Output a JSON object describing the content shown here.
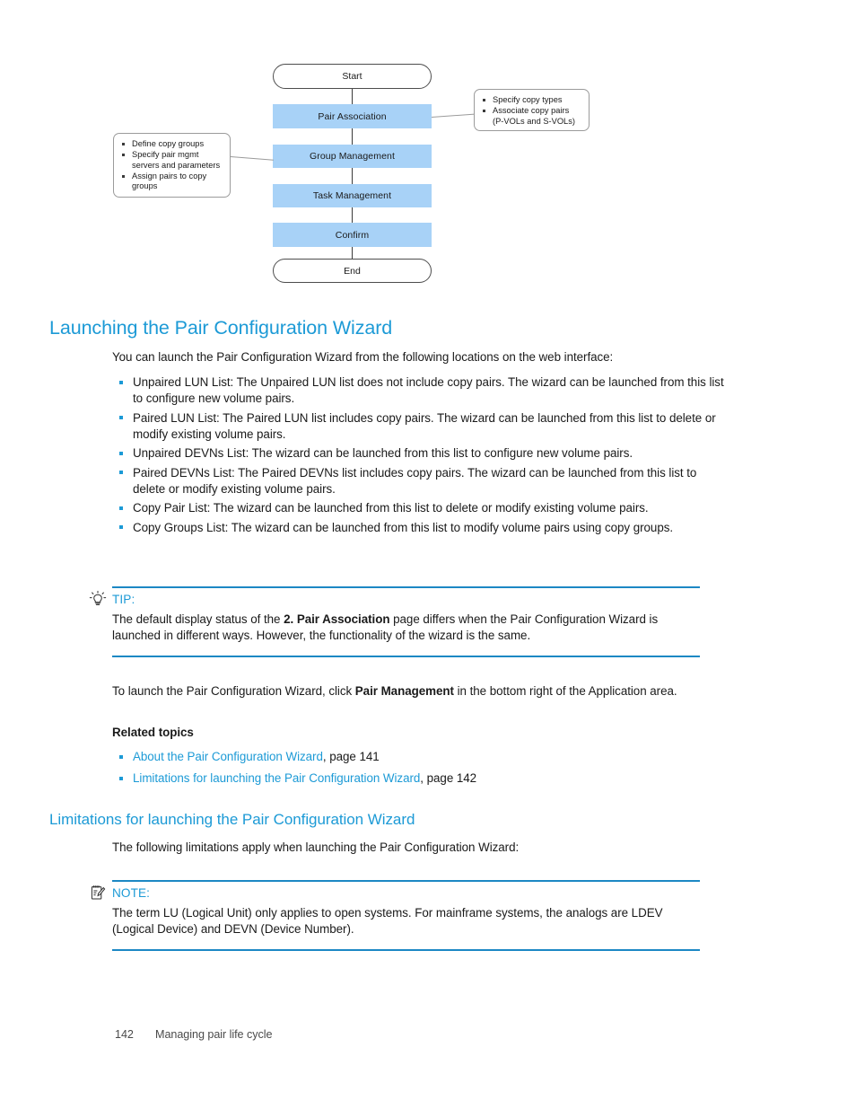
{
  "figure": {
    "nodes": [
      {
        "id": "start",
        "label": "Start",
        "shape": "terminator"
      },
      {
        "id": "pair-association",
        "label": "Pair Association",
        "shape": "process"
      },
      {
        "id": "group-management",
        "label": "Group Management",
        "shape": "process"
      },
      {
        "id": "task-management",
        "label": "Task Management",
        "shape": "process"
      },
      {
        "id": "confirm",
        "label": "Confirm",
        "shape": "process"
      },
      {
        "id": "end",
        "label": "End",
        "shape": "terminator"
      }
    ],
    "callout_right": {
      "items": [
        {
          "text": "Specify copy types",
          "cont": ""
        },
        {
          "text": "Associate copy pairs",
          "cont": "(P-VOLs and S-VOLs)"
        }
      ]
    },
    "callout_left": {
      "items": [
        {
          "text": "Define copy groups",
          "cont": ""
        },
        {
          "text": "Specify pair mgmt",
          "cont": "servers and parameters"
        },
        {
          "text": "Assign pairs to copy",
          "cont": "groups"
        }
      ]
    },
    "colors": {
      "process_fill": "#a8d2f7",
      "connector": "#3a3a3a",
      "callout_border": "#9b9b9b"
    }
  },
  "section": {
    "title": "Launching the Pair Configuration Wizard",
    "intro": "You can launch the Pair Configuration Wizard from the following locations on the web interface:",
    "bullets": [
      "Unpaired LUN List: The Unpaired LUN list does not include copy pairs. The wizard can be launched from this list to configure new volume pairs.",
      "Paired LUN List:  The Paired LUN list includes copy pairs. The wizard can be launched from this list to delete or modify existing volume pairs.",
      "Unpaired DEVNs List: The wizard can be launched from this list to configure new volume pairs.",
      "Paired DEVNs List: The Paired DEVNs list includes copy pairs. The wizard can be launched from this list to delete or modify existing volume pairs.",
      "Copy Pair List: The wizard can be launched from this list to delete or modify existing volume pairs.",
      "Copy Groups List: The wizard can be launched from this list to modify volume pairs using copy groups."
    ]
  },
  "tip": {
    "icon": "lightbulb-icon",
    "label": "TIP:",
    "text_part1": "The default display status  of  the ",
    "text_bold": "2. Pair Association",
    "text_part2": " page  differs when the Pair Configuration Wizard is launched in different ways. However, the functionality of the wizard is the same."
  },
  "launch_para": {
    "part1": "To launch the Pair Configuration Wizard, click ",
    "bold": "Pair Management",
    "part2": " in the bottom right of the Application area."
  },
  "related": {
    "heading": "Related topics",
    "links": [
      {
        "text": "About the Pair Configuration Wizard",
        "page_suffix": ", page 141"
      },
      {
        "text": "Limitations for launching the Pair Configuration Wizard",
        "page_suffix": ", page 142"
      }
    ]
  },
  "limitations": {
    "title": "Limitations for launching the Pair Configuration Wizard",
    "intro": "The following limitations apply when launching the Pair Configuration Wizard:"
  },
  "note": {
    "icon": "note-icon",
    "label": "NOTE:",
    "text": "The term LU (Logical Unit) only applies to open systems. For mainframe systems, the analogs are LDEV (Logical Device) and DEVN (Device Number)."
  },
  "footer": {
    "page_number": "142",
    "chapter": "Managing pair life cycle"
  },
  "colors": {
    "accent": "#1c9ad6",
    "rule": "#1c88c4",
    "bullet": "#1c9ad6"
  }
}
